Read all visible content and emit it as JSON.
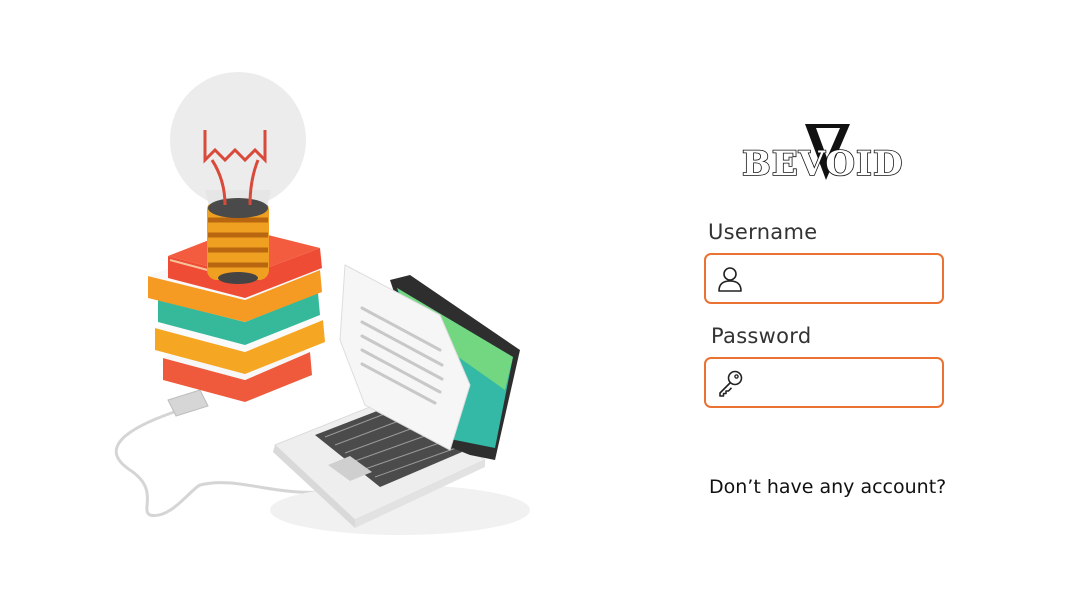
{
  "brand": {
    "logo_text": "BEVOID"
  },
  "illustration": {
    "icon": "lightbulb-books-laptop-illustration"
  },
  "login_form": {
    "username_label": "Username",
    "username_value": "",
    "username_icon": "user-icon",
    "password_label": "Password",
    "password_value": "",
    "password_icon": "key-icon",
    "signup_prompt": "Don’t have any account?"
  },
  "colors": {
    "accent": "#ea7334",
    "text": "#333333"
  }
}
